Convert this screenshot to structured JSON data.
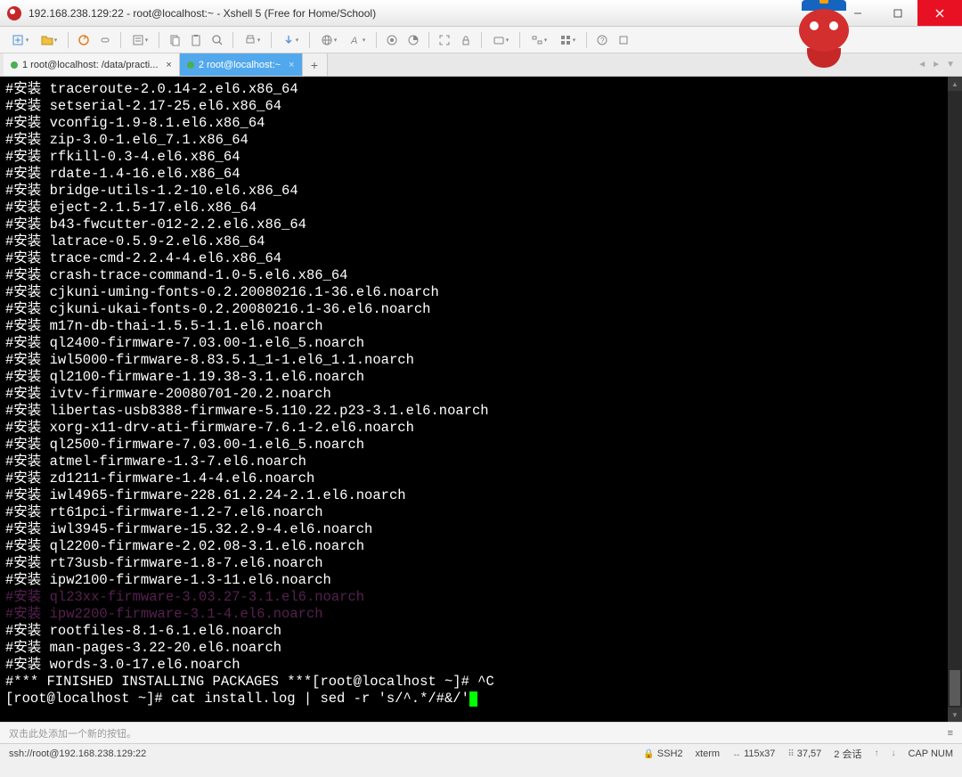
{
  "window": {
    "title": "192.168.238.129:22 - root@localhost:~ - Xshell 5 (Free for Home/School)"
  },
  "tabs": {
    "t1": "1 root@localhost: /data/practi...",
    "t2": "2 root@localhost:~",
    "new": "+"
  },
  "tabnav": {
    "left": "◄",
    "right": "►",
    "menu": "▼"
  },
  "addbar": {
    "hint": "双击此处添加一个新的按钮。"
  },
  "status": {
    "conn": "ssh://root@192.168.238.129:22",
    "proto": "SSH2",
    "term": "xterm",
    "size": "115x37",
    "pos": "37,57",
    "sess": "2 会话",
    "caps": "CAP  NUM"
  },
  "terminal": {
    "lines": [
      "#安装 traceroute-2.0.14-2.el6.x86_64",
      "#安装 setserial-2.17-25.el6.x86_64",
      "#安装 vconfig-1.9-8.1.el6.x86_64",
      "#安装 zip-3.0-1.el6_7.1.x86_64",
      "#安装 rfkill-0.3-4.el6.x86_64",
      "#安装 rdate-1.4-16.el6.x86_64",
      "#安装 bridge-utils-1.2-10.el6.x86_64",
      "#安装 eject-2.1.5-17.el6.x86_64",
      "#安装 b43-fwcutter-012-2.2.el6.x86_64",
      "#安装 latrace-0.5.9-2.el6.x86_64",
      "#安装 trace-cmd-2.2.4-4.el6.x86_64",
      "#安装 crash-trace-command-1.0-5.el6.x86_64",
      "#安装 cjkuni-uming-fonts-0.2.20080216.1-36.el6.noarch",
      "#安装 cjkuni-ukai-fonts-0.2.20080216.1-36.el6.noarch",
      "#安装 m17n-db-thai-1.5.5-1.1.el6.noarch",
      "#安装 ql2400-firmware-7.03.00-1.el6_5.noarch",
      "#安装 iwl5000-firmware-8.83.5.1_1-1.el6_1.1.noarch",
      "#安装 ql2100-firmware-1.19.38-3.1.el6.noarch",
      "#安装 ivtv-firmware-20080701-20.2.noarch",
      "#安装 libertas-usb8388-firmware-5.110.22.p23-3.1.el6.noarch",
      "#安装 xorg-x11-drv-ati-firmware-7.6.1-2.el6.noarch",
      "#安装 ql2500-firmware-7.03.00-1.el6_5.noarch",
      "#安装 atmel-firmware-1.3-7.el6.noarch",
      "#安装 zd1211-firmware-1.4-4.el6.noarch",
      "#安装 iwl4965-firmware-228.61.2.24-2.1.el6.noarch",
      "#安装 rt61pci-firmware-1.2-7.el6.noarch",
      "#安装 iwl3945-firmware-15.32.2.9-4.el6.noarch",
      "#安装 ql2200-firmware-2.02.08-3.1.el6.noarch",
      "#安装 rt73usb-firmware-1.8-7.el6.noarch",
      "#安装 ipw2100-firmware-1.3-11.el6.noarch"
    ],
    "dim1": "#安装 ql23xx-firmware-3.03.27-3.1.el6.noarch",
    "dim2": "#安装 ipw2200-firmware-3.1-4.el6.noarch",
    "tail": [
      "#安装 rootfiles-8.1-6.1.el6.noarch",
      "#安装 man-pages-3.22-20.el6.noarch",
      "#安装 words-3.0-17.el6.noarch",
      "#*** FINISHED INSTALLING PACKAGES ***[root@localhost ~]# ^C",
      "[root@localhost ~]# cat install.log | sed -r 's/^.*/#&/'"
    ]
  }
}
